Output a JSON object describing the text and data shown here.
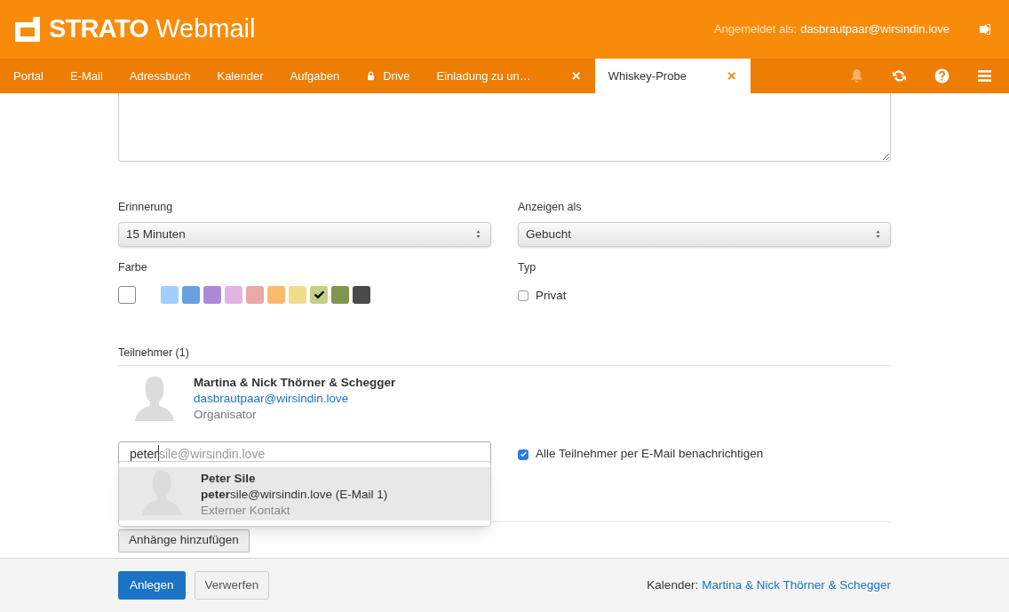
{
  "header": {
    "brand_bold": "STRATO",
    "brand_light": "Webmail",
    "login_label": "Angemeldet als:",
    "login_user": "dasbrautpaar@wirsindin.love"
  },
  "nav": [
    {
      "label": "Portal",
      "selected": false,
      "kind": "link"
    },
    {
      "label": "E-Mail",
      "selected": false,
      "kind": "link"
    },
    {
      "label": "Adressbuch",
      "selected": false,
      "kind": "link"
    },
    {
      "label": "Kalender",
      "selected": false,
      "kind": "link"
    },
    {
      "label": "Aufgaben",
      "selected": false,
      "kind": "link"
    },
    {
      "label": "Drive",
      "selected": false,
      "kind": "locked"
    },
    {
      "label": "Einladung zu un…",
      "selected": false,
      "kind": "closable",
      "close": "×"
    },
    {
      "label": "Whiskey-Probe",
      "selected": true,
      "kind": "closable",
      "close": "×"
    }
  ],
  "form": {
    "reminder": {
      "label": "Erinnerung",
      "value": "15 Minuten"
    },
    "show_as": {
      "label": "Anzeigen als",
      "value": "Gebucht"
    },
    "color_label": "Farbe",
    "colors": [
      {
        "color": "#ffffff",
        "kind": "none",
        "selected": false
      },
      {
        "color": "#9fd0ff",
        "kind": "swatch",
        "selected": false
      },
      {
        "color": "#6aa0e0",
        "kind": "swatch",
        "selected": false
      },
      {
        "color": "#a98ad8",
        "kind": "swatch",
        "selected": false
      },
      {
        "color": "#e2b4e4",
        "kind": "swatch",
        "selected": false
      },
      {
        "color": "#e8a9a9",
        "kind": "swatch",
        "selected": false
      },
      {
        "color": "#fdb96e",
        "kind": "swatch",
        "selected": false
      },
      {
        "color": "#f0dc8b",
        "kind": "swatch",
        "selected": false
      },
      {
        "color": "#c3d086",
        "kind": "swatch",
        "selected": true
      },
      {
        "color": "#7e9650",
        "kind": "swatch",
        "selected": false
      },
      {
        "color": "#4a4a4a",
        "kind": "swatch",
        "selected": false
      }
    ],
    "type_label": "Typ",
    "private": {
      "label": "Privat",
      "checked": false
    }
  },
  "participants": {
    "heading": "Teilnehmer (1)",
    "list": [
      {
        "name": "Martina & Nick Thörner & Schegger",
        "email": "dasbrautpaar@wirsindin.love",
        "role": "Organisator"
      }
    ],
    "input": {
      "value": "peter",
      "completion": "sile@wirsindin.love"
    },
    "notify": {
      "label": "Alle Teilnehmer per E-Mail benachrichtigen",
      "checked": true
    },
    "suggestions": [
      {
        "name": "Peter Sile",
        "email": "**peter**sile@wirsindin.love (E-Mail 1)",
        "note": "Externer Kontakt",
        "selected": true
      }
    ]
  },
  "attachments_button": "Anhänge hinzufügen",
  "footer": {
    "create": "Anlegen",
    "discard": "Verwerfen",
    "calendar_label": "Kalender:",
    "calendar_name": "Martina & Nick Thörner & Schegger"
  }
}
